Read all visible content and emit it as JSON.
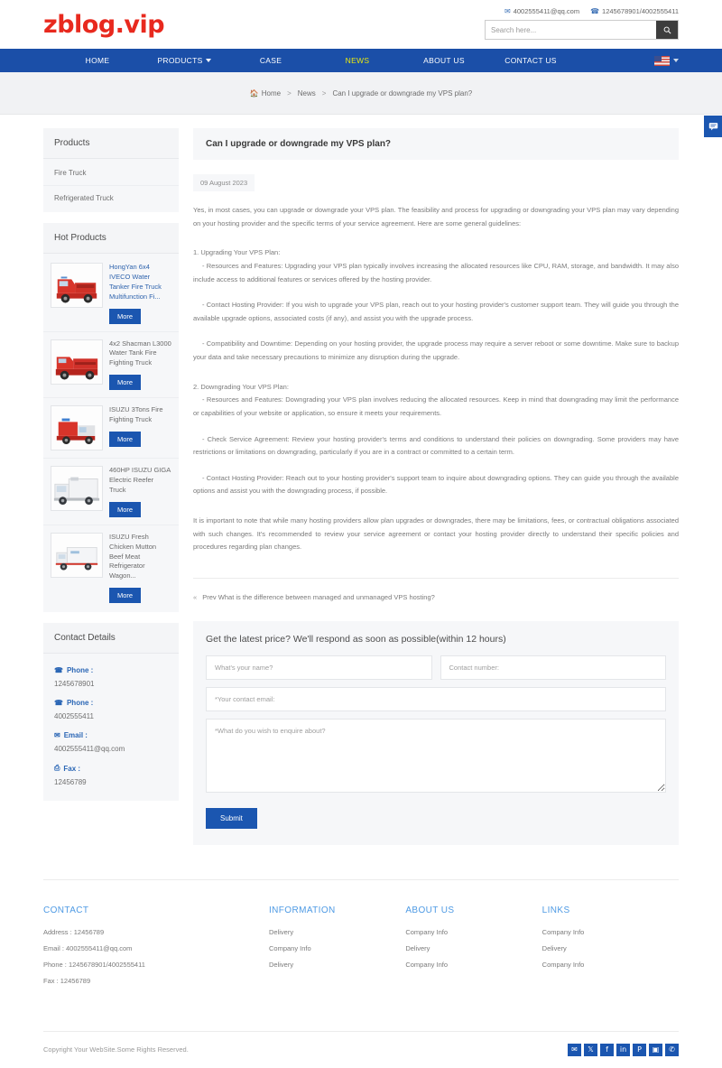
{
  "header": {
    "logo": "zblog.vip",
    "email": "4002555411@qq.com",
    "email_icon": "envelope-icon",
    "phone": "1245678901/4002555411",
    "phone_icon": "phone-icon",
    "search_placeholder": "Search here...",
    "search_value": "",
    "search_icon": "search-icon"
  },
  "nav": {
    "items": [
      {
        "label": "HOME",
        "active": false,
        "has_caret": false
      },
      {
        "label": "PRODUCTS",
        "active": false,
        "has_caret": true
      },
      {
        "label": "CASE",
        "active": false,
        "has_caret": false
      },
      {
        "label": "NEWS",
        "active": true,
        "has_caret": false
      },
      {
        "label": "ABOUT US",
        "active": false,
        "has_caret": false
      },
      {
        "label": "CONTACT US",
        "active": false,
        "has_caret": false
      }
    ],
    "language_flag": "us-flag-icon",
    "language_caret": "chevron-down-icon",
    "bar_color": "#1b4fa8",
    "active_color": "#e8e80f"
  },
  "breadcrumb": {
    "home_icon": "home-icon",
    "items": [
      "Home",
      "News",
      "Can I upgrade or downgrade my VPS plan?"
    ],
    "separator": ">"
  },
  "sidebar": {
    "products_panel": {
      "title": "Products",
      "items": [
        "Fire Truck",
        "Refrigerated Truck"
      ]
    },
    "hot_panel": {
      "title": "Hot Products",
      "more_label": "More",
      "items": [
        {
          "title": "HongYan 6x4 IVECO Water Tanker Fire Truck Multifunction Fi...",
          "link_style": "blue",
          "art": "red-fire-truck"
        },
        {
          "title": "4x2 Shacman L3000 Water Tank Fire Fighting Truck",
          "link_style": "grey",
          "art": "red-fire-truck"
        },
        {
          "title": "ISUZU 3Tons Fire Fighting Truck",
          "link_style": "grey",
          "art": "red-fire-truck-small"
        },
        {
          "title": "460HP ISUZU GIGA Electric Reefer Truck",
          "link_style": "grey",
          "art": "white-reefer-truck"
        },
        {
          "title": "ISUZU Fresh Chicken Mutton Beef Meat Refrigerator Wagon...",
          "link_style": "grey",
          "art": "white-box-truck"
        }
      ]
    },
    "contact_panel": {
      "title": "Contact Details",
      "rows": [
        {
          "label": "Phone :",
          "icon": "phone-icon",
          "value": "1245678901"
        },
        {
          "label": "Phone :",
          "icon": "phone-icon",
          "value": "4002555411"
        },
        {
          "label": "Email :",
          "icon": "envelope-icon",
          "value": "4002555411@qq.com"
        },
        {
          "label": "Fax :",
          "icon": "fax-icon",
          "value": "12456789"
        }
      ]
    }
  },
  "article": {
    "title": "Can I upgrade or downgrade my VPS plan?",
    "date": "09 August 2023",
    "intro": "Yes, in most cases, you can upgrade or downgrade your VPS plan. The feasibility and process for upgrading or downgrading your VPS plan may vary depending on your hosting provider and the specific terms of your service agreement. Here are some general guidelines:",
    "section1_heading": "1. Upgrading Your VPS Plan:",
    "section1_bullets": [
      "- Resources and Features: Upgrading your VPS plan typically involves increasing the allocated resources like CPU, RAM, storage, and bandwidth. It may also include access to additional features or services offered by the hosting provider.",
      "- Contact Hosting Provider: If you wish to upgrade your VPS plan, reach out to your hosting provider's customer support team. They will guide you through the available upgrade options, associated costs (if any), and assist you with the upgrade process.",
      "- Compatibility and Downtime: Depending on your hosting provider, the upgrade process may require a server reboot or some downtime. Make sure to backup your data and take necessary precautions to minimize any disruption during the upgrade."
    ],
    "section2_heading": "2. Downgrading Your VPS Plan:",
    "section2_bullets": [
      "- Resources and Features: Downgrading your VPS plan involves reducing the allocated resources. Keep in mind that downgrading may limit the performance or capabilities of your website or application, so ensure it meets your requirements.",
      "- Check Service Agreement: Review your hosting provider's terms and conditions to understand their policies on downgrading. Some providers may have restrictions or limitations on downgrading, particularly if you are in a contract or committed to a certain term.",
      "- Contact Hosting Provider: Reach out to your hosting provider's support team to inquire about downgrading options. They can guide you through the available options and assist you with the downgrading process, if possible."
    ],
    "closing": "It is important to note that while many hosting providers allow plan upgrades or downgrades, there may be limitations, fees, or contractual obligations associated with such changes. It's recommended to review your service agreement or contact your hosting provider directly to understand their specific policies and procedures regarding plan changes.",
    "prev_icon": "double-chevron-left-icon",
    "prev_label": "Prev What is the difference between managed and unmanaged VPS hosting?"
  },
  "enquiry": {
    "heading": "Get the latest price? We'll respond as soon as possible(within 12 hours)",
    "name_placeholder": "What's your name?",
    "name_value": "",
    "phone_placeholder": "Contact number:",
    "phone_value": "",
    "email_placeholder": "*Your contact email:",
    "email_value": "",
    "message_placeholder": "*What do you wish to enquire about?",
    "message_value": "",
    "submit_label": "Submit",
    "button_color": "#1b56b0"
  },
  "footer": {
    "columns": [
      {
        "title": "CONTACT",
        "lines": [
          "Address : 12456789",
          "Email : 4002555411@qq.com",
          "Phone : 1245678901/4002555411",
          "Fax : 12456789"
        ]
      },
      {
        "title": "INFORMATION",
        "lines": [
          "Delivery",
          "Company Info",
          "Delivery"
        ]
      },
      {
        "title": "ABOUT US",
        "lines": [
          "Company Info",
          "Delivery",
          "Company Info"
        ]
      },
      {
        "title": "LINKS",
        "lines": [
          "Company Info",
          "Delivery",
          "Company Info"
        ]
      }
    ],
    "heading_color": "#4e9ae4",
    "copyright": "Copyright Your WebSite.Some Rights Reserved.",
    "socials": [
      {
        "name": "email-share-icon",
        "glyph": "✉"
      },
      {
        "name": "twitter-icon",
        "glyph": "𝕏"
      },
      {
        "name": "facebook-icon",
        "glyph": "f"
      },
      {
        "name": "linkedin-icon",
        "glyph": "in"
      },
      {
        "name": "pinterest-icon",
        "glyph": "P"
      },
      {
        "name": "instagram-icon",
        "glyph": "▣"
      },
      {
        "name": "whatsapp-icon",
        "glyph": "✆"
      }
    ]
  },
  "chat_widget": {
    "icon": "chat-bubble-icon",
    "color": "#1b56b0"
  }
}
